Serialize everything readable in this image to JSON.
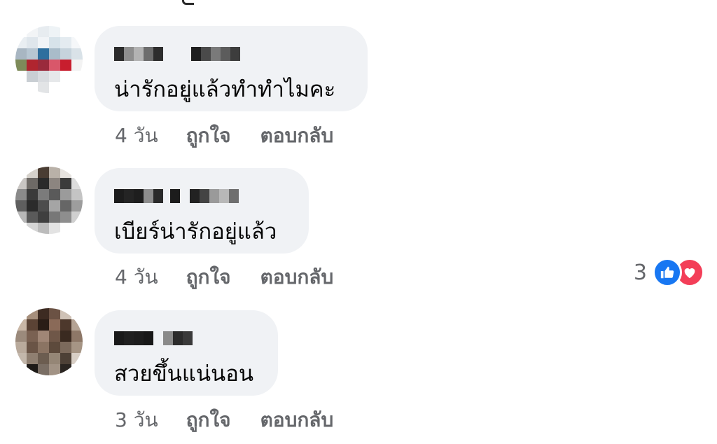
{
  "comments": [
    {
      "text": "น่ารักอยู่แล้วทำทำไมคะ",
      "time": "4 วัน",
      "like_label": "ถูกใจ",
      "reply_label": "ตอบกลับ"
    },
    {
      "text": "เบียร์น่ารักอยู่แล้ว",
      "time": "4 วัน",
      "like_label": "ถูกใจ",
      "reply_label": "ตอบกลับ",
      "reaction_count": "3",
      "reactions": [
        "like-icon",
        "love-icon"
      ]
    },
    {
      "text": "สวยขึ้นแน่นอน",
      "time": "3 วัน",
      "like_label": "ถูกใจ",
      "reply_label": "ตอบกลับ"
    }
  ],
  "colors": {
    "bubble": "#f0f2f5",
    "meta_text": "#65676b",
    "like_blue": "#1877f2",
    "love_red": "#f33e58"
  }
}
